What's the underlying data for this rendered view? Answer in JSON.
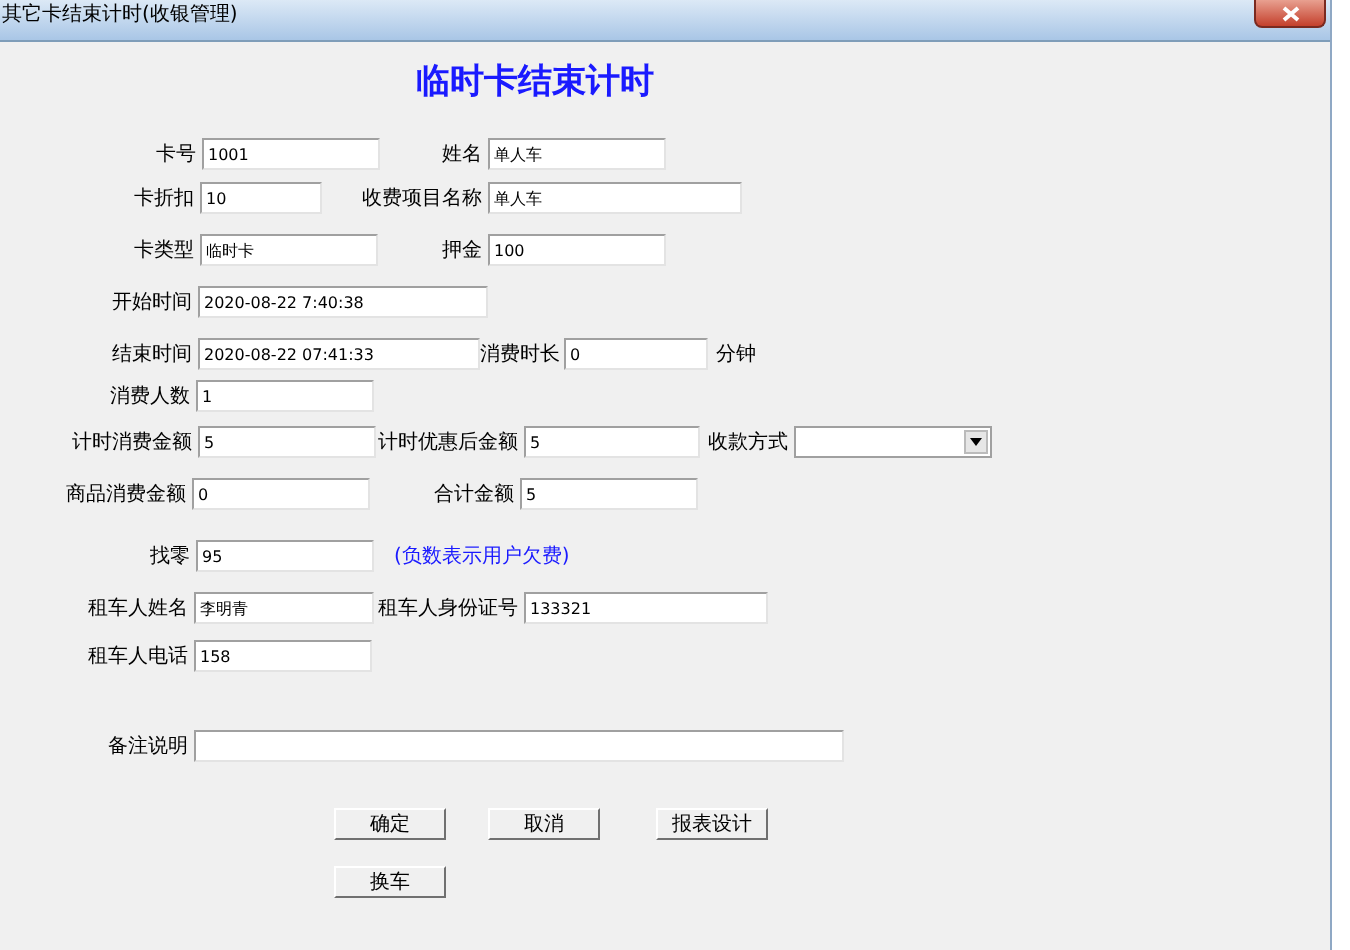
{
  "window": {
    "title": "其它卡结束计时(收银管理)"
  },
  "heading": "临时卡结束计时",
  "rows": [
    [
      {
        "kind": "input",
        "label": "卡号",
        "value": "1001"
      },
      {
        "kind": "input",
        "label": "姓名",
        "value": "单人车"
      }
    ],
    [
      {
        "kind": "input",
        "label": "卡折扣",
        "value": "10"
      },
      {
        "kind": "input",
        "label": "收费项目名称",
        "value": "单人车"
      }
    ],
    [
      {
        "kind": "input",
        "label": "卡类型",
        "value": "临时卡"
      },
      {
        "kind": "input",
        "label": "押金",
        "value": "100"
      }
    ],
    [
      {
        "kind": "input",
        "label": "开始时间",
        "value": "2020-08-22 7:40:38"
      }
    ],
    [
      {
        "kind": "input",
        "label": "结束时间",
        "value": "2020-08-22 07:41:33"
      },
      {
        "kind": "input",
        "label": "消费时长",
        "value": "0"
      },
      {
        "kind": "unit",
        "text": "分钟"
      }
    ],
    [
      {
        "kind": "input",
        "label": "消费人数",
        "value": "1"
      }
    ],
    [
      {
        "kind": "input",
        "label": "计时消费金额",
        "value": "5"
      },
      {
        "kind": "input",
        "label": "计时优惠后金额",
        "value": "5"
      },
      {
        "kind": "select",
        "label": "收款方式"
      }
    ],
    [
      {
        "kind": "input",
        "label": "商品消费金额",
        "value": "0"
      },
      {
        "kind": "input",
        "label": "合计金额",
        "value": "5"
      }
    ],
    [
      {
        "kind": "input",
        "label": "找零",
        "value": "95"
      },
      {
        "kind": "note",
        "text": "(负数表示用户欠费)"
      }
    ],
    [
      {
        "kind": "input",
        "label": "租车人姓名",
        "value": "李明青"
      },
      {
        "kind": "input",
        "label": "租车人身份证号",
        "value": "133321"
      }
    ],
    [
      {
        "kind": "input",
        "label": "租车人电话",
        "value": "158"
      }
    ],
    [
      {
        "kind": "input",
        "label": "备注说明"
      }
    ]
  ],
  "buttons": [
    {
      "label": "确定"
    },
    {
      "label": "取消"
    },
    {
      "label": "报表设计"
    },
    {
      "label": "换车"
    }
  ]
}
